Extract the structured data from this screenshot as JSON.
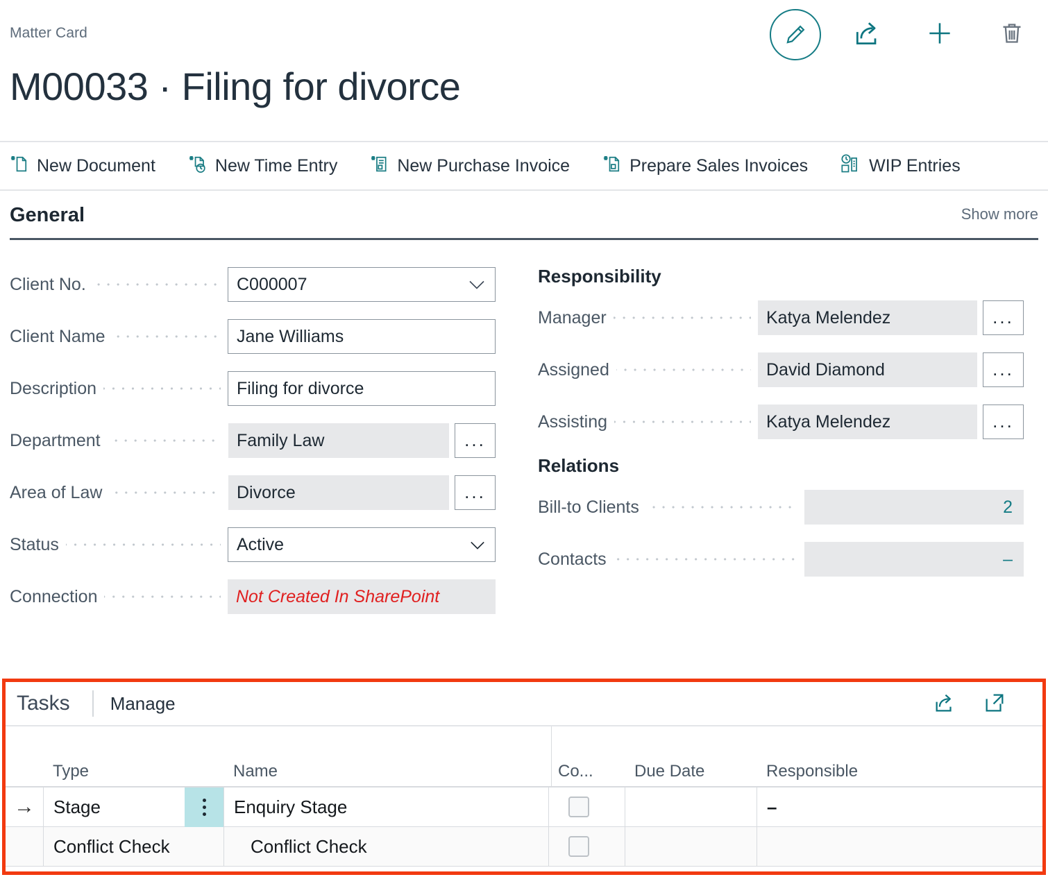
{
  "breadcrumb": "Matter Card",
  "page_title": "M00033 · Filing for divorce",
  "colors": {
    "teal": "#157c85",
    "highlight_border": "#f23a10",
    "row_accent": "#b7e3e7",
    "error_text": "#e02020"
  },
  "top_icons": [
    {
      "name": "edit-icon",
      "label": "Edit"
    },
    {
      "name": "share-icon",
      "label": "Share"
    },
    {
      "name": "add-icon",
      "label": "New"
    },
    {
      "name": "delete-icon",
      "label": "Delete"
    }
  ],
  "action_bar": [
    {
      "icon": "new-document-icon",
      "label": "New Document"
    },
    {
      "icon": "new-time-entry-icon",
      "label": "New Time Entry"
    },
    {
      "icon": "new-purchase-invoice-icon",
      "label": "New Purchase Invoice"
    },
    {
      "icon": "prepare-sales-invoices-icon",
      "label": "Prepare Sales Invoices"
    },
    {
      "icon": "wip-entries-icon",
      "label": "WIP Entries"
    }
  ],
  "general": {
    "heading": "General",
    "show_more": "Show more",
    "fields": {
      "client_no": {
        "label": "Client No.",
        "value": "C000007"
      },
      "client_name": {
        "label": "Client Name",
        "value": "Jane Williams"
      },
      "description": {
        "label": "Description",
        "value": "Filing for divorce"
      },
      "department": {
        "label": "Department",
        "value": "Family Law",
        "assist": "..."
      },
      "area_of_law": {
        "label": "Area of Law",
        "value": "Divorce",
        "assist": "..."
      },
      "status": {
        "label": "Status",
        "value": "Active"
      },
      "connection": {
        "label": "Connection",
        "value": "Not Created In SharePoint"
      }
    }
  },
  "responsibility": {
    "heading": "Responsibility",
    "fields": {
      "manager": {
        "label": "Manager",
        "value": "Katya Melendez",
        "assist": "..."
      },
      "assigned": {
        "label": "Assigned",
        "value": "David Diamond",
        "assist": "..."
      },
      "assisting": {
        "label": "Assisting",
        "value": "Katya Melendez",
        "assist": "..."
      }
    }
  },
  "relations": {
    "heading": "Relations",
    "fields": {
      "bill_to_clients": {
        "label": "Bill-to Clients",
        "value": "2"
      },
      "contacts": {
        "label": "Contacts",
        "value": "–"
      }
    }
  },
  "tasks": {
    "title": "Tasks",
    "manage": "Manage",
    "icons": [
      {
        "name": "share-icon",
        "label": "Share"
      },
      {
        "name": "open-in-new-window-icon",
        "label": "Open in new window"
      }
    ],
    "columns": [
      {
        "key": "type",
        "label": "Type"
      },
      {
        "key": "name",
        "label": "Name"
      },
      {
        "key": "completed",
        "label": "Co..."
      },
      {
        "key": "due_date",
        "label": "Due Date"
      },
      {
        "key": "responsible",
        "label": "Responsible"
      }
    ],
    "rows": [
      {
        "selected": true,
        "arrow": "→",
        "type": "Stage",
        "name": "Enquiry Stage",
        "indented": false,
        "completed": false,
        "due_date": "",
        "responsible": "–"
      },
      {
        "selected": false,
        "arrow": "",
        "type": "Conflict Check",
        "name": "Conflict Check",
        "indented": true,
        "completed": false,
        "due_date": "",
        "responsible": ""
      }
    ]
  }
}
